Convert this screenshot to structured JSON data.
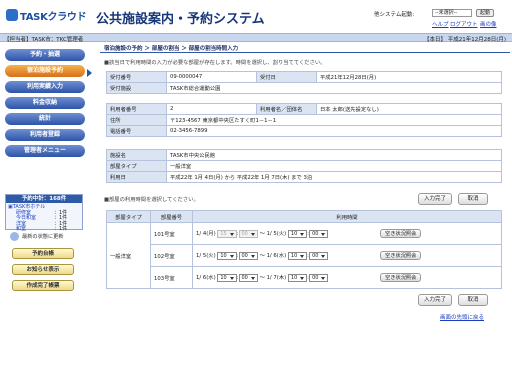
{
  "header": {
    "logo_text": "TASKクラウド",
    "title": "公共施設案内・予約システム",
    "system_launch_label": "他システム起動:",
    "system_select_value": "--未選択--",
    "launch_button": "起動",
    "help_link": "ヘルプ",
    "logout_link": "ログアウト",
    "print_link": "画の像"
  },
  "status_bar": {
    "user_info": "【担当者】TASK市：TKC管理者",
    "date_info": "【本日】 平成21年12月28日(月)"
  },
  "sidebar": {
    "menu": [
      {
        "label": "予約・抽選"
      },
      {
        "label": "宿泊施設予約"
      },
      {
        "label": "利用実績入力"
      },
      {
        "label": "料金収納"
      },
      {
        "label": "統計"
      },
      {
        "label": "利用者登録"
      },
      {
        "label": "管理者メニュー"
      }
    ],
    "reserve_panel": {
      "title": "予約中計：168件",
      "tree_root": "TASK市ホテル",
      "items": [
        {
          "name": "研修室",
          "count": "：1件"
        },
        {
          "name": "今日和室",
          "count": "：1件"
        },
        {
          "name": "洋室",
          "count": "：1件"
        },
        {
          "name": "和室",
          "count": "：1件"
        }
      ]
    },
    "refresh_label": "最新の状態に更新",
    "buttons": [
      {
        "label": "予約台帳"
      },
      {
        "label": "お知らせ表示"
      },
      {
        "label": "作成完了帳票"
      }
    ]
  },
  "main": {
    "title": "宿泊施設の予約 ＞ 部屋の割当 ＞ 部屋の割当時間入力",
    "note1": "■該当日で利用時間の入力が必要な部屋が存在します。時間を選択し、割り当ててください。",
    "reception": {
      "no_label": "受付番号",
      "no_value": "09-0000047",
      "date_label": "受付日",
      "date_value": "平成21年12月28日(月)",
      "facility_label": "受付施設",
      "facility_value": "TASK市総合運動公園"
    },
    "user": {
      "no_label": "利用者番号",
      "no_value": "2",
      "name_label": "利用者名／団体名",
      "name_value": "日本 太郎(送先設定なし)",
      "addr_label": "住所",
      "addr_value": "〒123-4567 東京都中央区たすく町1－1－1",
      "tel_label": "電話番号",
      "tel_value": "02-3456-7899"
    },
    "facility": {
      "name_label": "施設名",
      "name_value": "TASK市中央公民館",
      "type_label": "部屋タイプ",
      "type_value": "一般洋室",
      "date_label": "利用日",
      "date_value": "平成22年 1月 4日(月) から 平成22年 1月 7日(木) まで 3泊"
    },
    "note2": "■部屋の利用時間を選択してください。",
    "input_complete": "入力完了",
    "cancel": "取消",
    "room_table": {
      "col_type": "部屋タイプ",
      "col_no": "部屋番号",
      "col_time": "利用時間",
      "room_type": "一般洋室",
      "tilde": "～",
      "colon": ":",
      "availability": "空き状況照会",
      "rows": [
        {
          "room": "101号室",
          "from_date": "1/ 4(月)",
          "from_h": "15",
          "from_m": "00",
          "to_date": "1/ 5(火)",
          "to_h": "10",
          "to_m": "00",
          "from_disabled": true
        },
        {
          "room": "102号室",
          "from_date": "1/ 5(火)",
          "from_h": "10",
          "from_m": "00",
          "to_date": "1/ 6(水)",
          "to_h": "10",
          "to_m": "00",
          "from_disabled": false
        },
        {
          "room": "103号室",
          "from_date": "1/ 6(水)",
          "from_h": "10",
          "from_m": "00",
          "to_date": "1/ 7(木)",
          "to_h": "10",
          "to_m": "00",
          "from_disabled": false
        }
      ]
    },
    "back_to_top": "画面の先頭に戻る"
  }
}
